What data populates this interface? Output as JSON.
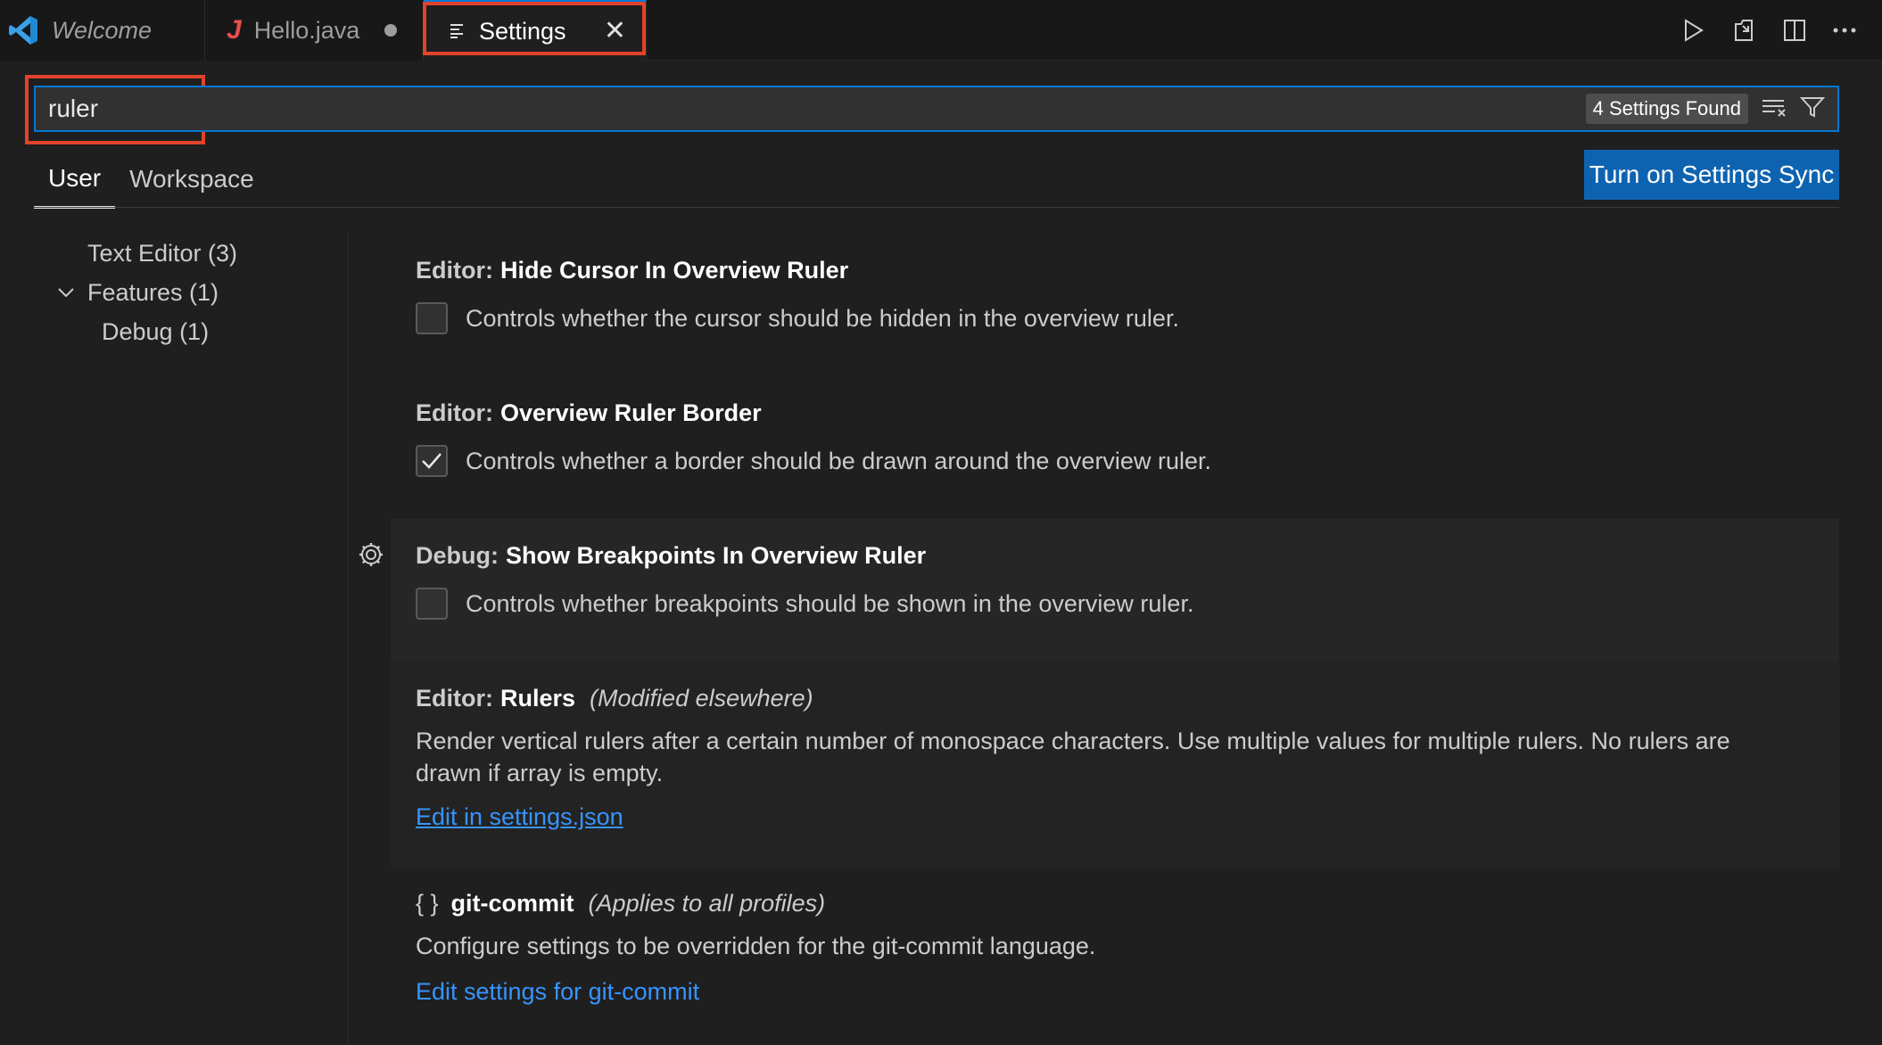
{
  "tabs": [
    {
      "label": "Welcome",
      "italic": true
    },
    {
      "label": "Hello.java",
      "icon": "java-icon",
      "modified": true
    },
    {
      "label": "Settings",
      "icon": "settings-editor-icon",
      "active": true
    }
  ],
  "search": {
    "value": "ruler",
    "found_label": "4 Settings Found"
  },
  "scope_tabs": {
    "user": "User",
    "workspace": "Workspace"
  },
  "sync_button": "Turn on Settings Sync",
  "toc": [
    {
      "label": "Text Editor (3)"
    },
    {
      "label": "Features (1)",
      "expanded": true
    },
    {
      "label": "Debug (1)"
    }
  ],
  "settings": [
    {
      "category": "Editor:",
      "name": "Hide Cursor In Overview Ruler",
      "description": "Controls whether the cursor should be hidden in the overview ruler.",
      "checked": false
    },
    {
      "category": "Editor:",
      "name": "Overview Ruler Border",
      "description": "Controls whether a border should be drawn around the overview ruler.",
      "checked": true
    },
    {
      "category": "Debug:",
      "name": "Show Breakpoints In Overview Ruler",
      "description": "Controls whether breakpoints should be shown in the overview ruler.",
      "checked": false
    },
    {
      "category": "Editor:",
      "name": "Rulers",
      "note": "(Modified elsewhere)",
      "description_line1": "Render vertical rulers after a certain number of monospace characters. Use multiple values for multiple rulers. No rulers are",
      "description_line2": "drawn if array is empty.",
      "link": "Edit in settings.json"
    },
    {
      "braces": "{ }",
      "name": "git-commit",
      "note": "(Applies to all profiles)",
      "description": "Configure settings to be overridden for the git-commit language.",
      "link": "Edit settings for git-commit"
    }
  ],
  "colors": {
    "accent": "#0078d4",
    "highlight": "#e2432a",
    "link": "#3794ff",
    "sync_button": "#0e63b0"
  }
}
